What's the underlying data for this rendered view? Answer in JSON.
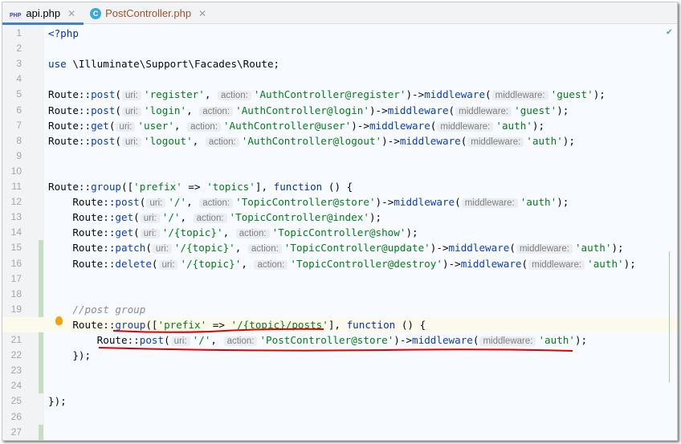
{
  "tabs": [
    {
      "label": "api.php",
      "icon": "php-file-icon",
      "active": true
    },
    {
      "label": "PostController.php",
      "icon": "class-icon",
      "active": false
    }
  ],
  "status_icon": "check-icon",
  "current_line": 20,
  "lines": [
    [
      [
        "k",
        "<?php"
      ]
    ],
    [],
    [
      [
        "k",
        "use"
      ],
      [
        "p",
        " \\Illuminate\\Support\\Facades\\Route;"
      ]
    ],
    [],
    [
      [
        "p",
        "Route::"
      ],
      [
        "f",
        "post"
      ],
      [
        "p",
        "("
      ],
      [
        "h",
        "uri:"
      ],
      [
        "s",
        "'register'"
      ],
      [
        "p",
        ", "
      ],
      [
        "h",
        "action:"
      ],
      [
        "s",
        "'AuthController@register'"
      ],
      [
        "p",
        ")->"
      ],
      [
        "f",
        "middleware"
      ],
      [
        "p",
        "("
      ],
      [
        "h",
        "middleware:"
      ],
      [
        "s",
        "'guest'"
      ],
      [
        "p",
        ");"
      ]
    ],
    [
      [
        "p",
        "Route::"
      ],
      [
        "f",
        "post"
      ],
      [
        "p",
        "("
      ],
      [
        "h",
        "uri:"
      ],
      [
        "s",
        "'login'"
      ],
      [
        "p",
        ", "
      ],
      [
        "h",
        "action:"
      ],
      [
        "s",
        "'AuthController@login'"
      ],
      [
        "p",
        ")->"
      ],
      [
        "f",
        "middleware"
      ],
      [
        "p",
        "("
      ],
      [
        "h",
        "middleware:"
      ],
      [
        "s",
        "'guest'"
      ],
      [
        "p",
        ");"
      ]
    ],
    [
      [
        "p",
        "Route::"
      ],
      [
        "f",
        "get"
      ],
      [
        "p",
        "("
      ],
      [
        "h",
        "uri:"
      ],
      [
        "s",
        "'user'"
      ],
      [
        "p",
        ", "
      ],
      [
        "h",
        "action:"
      ],
      [
        "s",
        "'AuthController@user'"
      ],
      [
        "p",
        ")->"
      ],
      [
        "f",
        "middleware"
      ],
      [
        "p",
        "("
      ],
      [
        "h",
        "middleware:"
      ],
      [
        "s",
        "'auth'"
      ],
      [
        "p",
        ");"
      ]
    ],
    [
      [
        "p",
        "Route::"
      ],
      [
        "f",
        "post"
      ],
      [
        "p",
        "("
      ],
      [
        "h",
        "uri:"
      ],
      [
        "s",
        "'logout'"
      ],
      [
        "p",
        ", "
      ],
      [
        "h",
        "action:"
      ],
      [
        "s",
        "'AuthController@logout'"
      ],
      [
        "p",
        ")->"
      ],
      [
        "f",
        "middleware"
      ],
      [
        "p",
        "("
      ],
      [
        "h",
        "middleware:"
      ],
      [
        "s",
        "'auth'"
      ],
      [
        "p",
        ");"
      ]
    ],
    [],
    [],
    [
      [
        "p",
        "Route::"
      ],
      [
        "f",
        "group"
      ],
      [
        "p",
        "(["
      ],
      [
        "s",
        "'prefix'"
      ],
      [
        "p",
        " => "
      ],
      [
        "s",
        "'topics'"
      ],
      [
        "p",
        "], "
      ],
      [
        "k",
        "function"
      ],
      [
        "p",
        " () {"
      ]
    ],
    [
      [
        "p",
        "    Route::"
      ],
      [
        "f",
        "post"
      ],
      [
        "p",
        "("
      ],
      [
        "h",
        "uri:"
      ],
      [
        "s",
        "'/'"
      ],
      [
        "p",
        ", "
      ],
      [
        "h",
        "action:"
      ],
      [
        "s",
        "'TopicController@store'"
      ],
      [
        "p",
        ")->"
      ],
      [
        "f",
        "middleware"
      ],
      [
        "p",
        "("
      ],
      [
        "h",
        "middleware:"
      ],
      [
        "s",
        "'auth'"
      ],
      [
        "p",
        ");"
      ]
    ],
    [
      [
        "p",
        "    Route::"
      ],
      [
        "f",
        "get"
      ],
      [
        "p",
        "("
      ],
      [
        "h",
        "uri:"
      ],
      [
        "s",
        "'/'"
      ],
      [
        "p",
        ", "
      ],
      [
        "h",
        "action:"
      ],
      [
        "s",
        "'TopicController@index'"
      ],
      [
        "p",
        ");"
      ]
    ],
    [
      [
        "p",
        "    Route::"
      ],
      [
        "f",
        "get"
      ],
      [
        "p",
        "("
      ],
      [
        "h",
        "uri:"
      ],
      [
        "s",
        "'/{topic}'"
      ],
      [
        "p",
        ", "
      ],
      [
        "h",
        "action:"
      ],
      [
        "s",
        "'TopicController@show'"
      ],
      [
        "p",
        ");"
      ]
    ],
    [
      [
        "p",
        "    Route::"
      ],
      [
        "f",
        "patch"
      ],
      [
        "p",
        "("
      ],
      [
        "h",
        "uri:"
      ],
      [
        "s",
        "'/{topic}'"
      ],
      [
        "p",
        ", "
      ],
      [
        "h",
        "action:"
      ],
      [
        "s",
        "'TopicController@update'"
      ],
      [
        "p",
        ")->"
      ],
      [
        "f",
        "middleware"
      ],
      [
        "p",
        "("
      ],
      [
        "h",
        "middleware:"
      ],
      [
        "s",
        "'auth'"
      ],
      [
        "p",
        ");"
      ]
    ],
    [
      [
        "p",
        "    Route::"
      ],
      [
        "f",
        "delete"
      ],
      [
        "p",
        "("
      ],
      [
        "h",
        "uri:"
      ],
      [
        "s",
        "'/{topic}'"
      ],
      [
        "p",
        ", "
      ],
      [
        "h",
        "action:"
      ],
      [
        "s",
        "'TopicController@destroy'"
      ],
      [
        "p",
        ")->"
      ],
      [
        "f",
        "middleware"
      ],
      [
        "p",
        "("
      ],
      [
        "h",
        "middleware:"
      ],
      [
        "s",
        "'auth'"
      ],
      [
        "p",
        ");"
      ]
    ],
    [],
    [],
    [
      [
        "c",
        "    //post group"
      ]
    ],
    [
      [
        "p",
        "    Route::"
      ],
      [
        "f",
        "group"
      ],
      [
        "p",
        "(["
      ],
      [
        "s",
        "'prefix'"
      ],
      [
        "p",
        " => "
      ],
      [
        "s",
        "'/{topic}/posts'"
      ],
      [
        "p",
        "], "
      ],
      [
        "k",
        "function"
      ],
      [
        "p",
        " () {"
      ]
    ],
    [
      [
        "p",
        "        Route::"
      ],
      [
        "f",
        "post"
      ],
      [
        "p",
        "("
      ],
      [
        "h",
        "uri:"
      ],
      [
        "s",
        "'/'"
      ],
      [
        "p",
        ", "
      ],
      [
        "h",
        "action:"
      ],
      [
        "s",
        "'PostController@store'"
      ],
      [
        "p",
        ")->"
      ],
      [
        "f",
        "middleware"
      ],
      [
        "p",
        "("
      ],
      [
        "h",
        "middleware:"
      ],
      [
        "s",
        "'auth'"
      ],
      [
        "p",
        ");"
      ]
    ],
    [
      [
        "p",
        "    });"
      ]
    ],
    [],
    [],
    [
      [
        "p",
        "});"
      ]
    ],
    [],
    []
  ],
  "annotation_color": "#e00000"
}
